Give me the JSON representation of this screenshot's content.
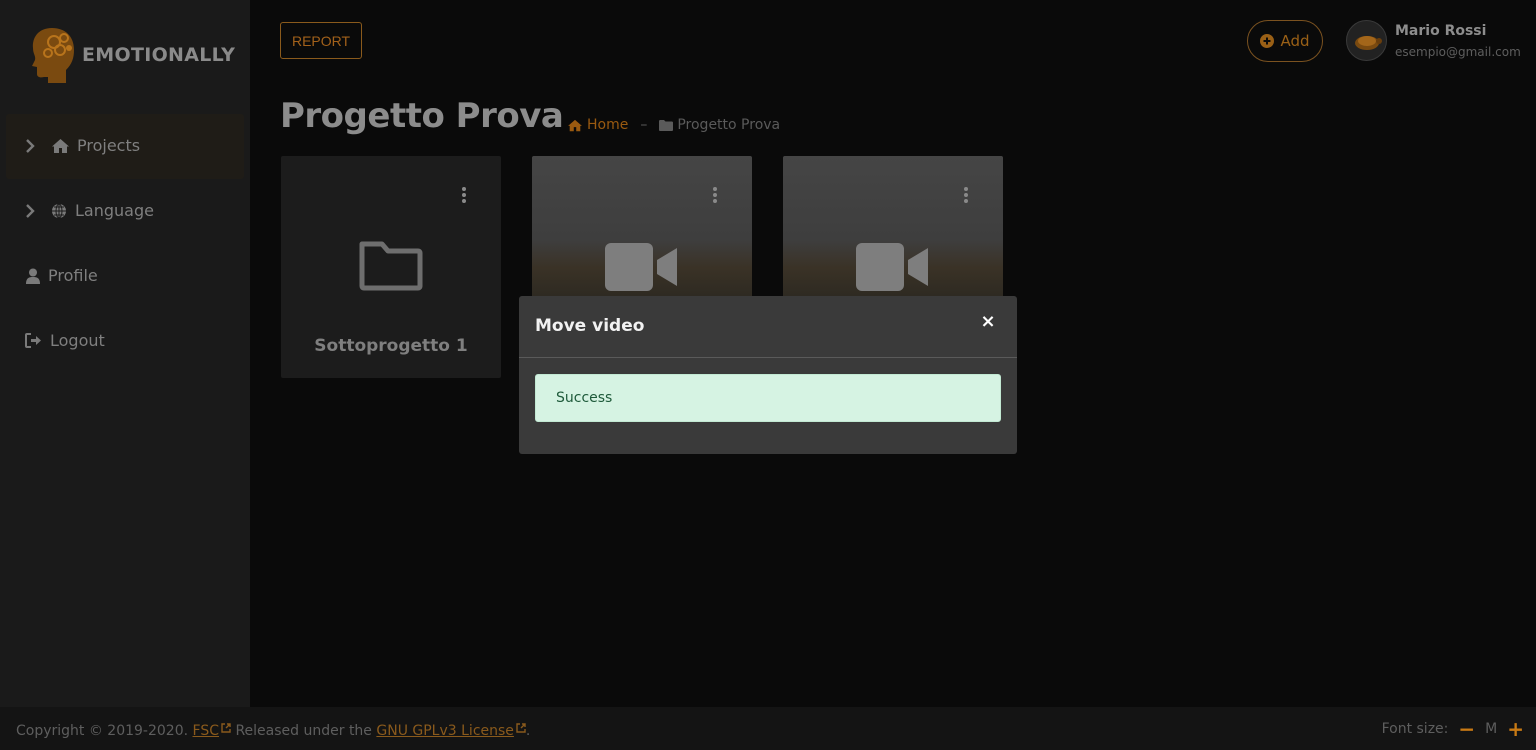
{
  "app": {
    "brand": "EMOTIONALLY"
  },
  "sidebar": {
    "items": [
      {
        "label": "Projects",
        "icon": "home-icon",
        "active": true
      },
      {
        "label": "Language",
        "icon": "globe-icon"
      },
      {
        "label": "Profile",
        "icon": "user-icon"
      },
      {
        "label": "Logout",
        "icon": "logout-icon"
      }
    ]
  },
  "header": {
    "report_label": "REPORT",
    "add_label": "Add",
    "user": {
      "name": "Mario Rossi",
      "email": "esempio@gmail.com"
    }
  },
  "page": {
    "title": "Progetto Prova",
    "breadcrumb": {
      "home": "Home",
      "separator": "–",
      "current": "Progetto Prova"
    }
  },
  "cards": [
    {
      "type": "folder",
      "title": "Sottoprogetto 1"
    },
    {
      "type": "video",
      "title": ""
    },
    {
      "type": "video",
      "title": ""
    }
  ],
  "modal": {
    "title": "Move video",
    "close": "×",
    "alert": "Success"
  },
  "footer": {
    "copyright_prefix": "Copyright © 2019-2020.",
    "fsc_link": "FSC",
    "released": "Released under the",
    "license_link": "GNU GPLv3 License",
    "period": ".",
    "font_size_label": "Font size:",
    "font_size_value": "M",
    "minus": "−",
    "plus": "+"
  },
  "colors": {
    "accent": "#c97a14",
    "background": "#0a0a0a",
    "sidebar": "#1a1a1a",
    "modal": "#3a3a3a",
    "success_bg": "#d6f3e3"
  }
}
